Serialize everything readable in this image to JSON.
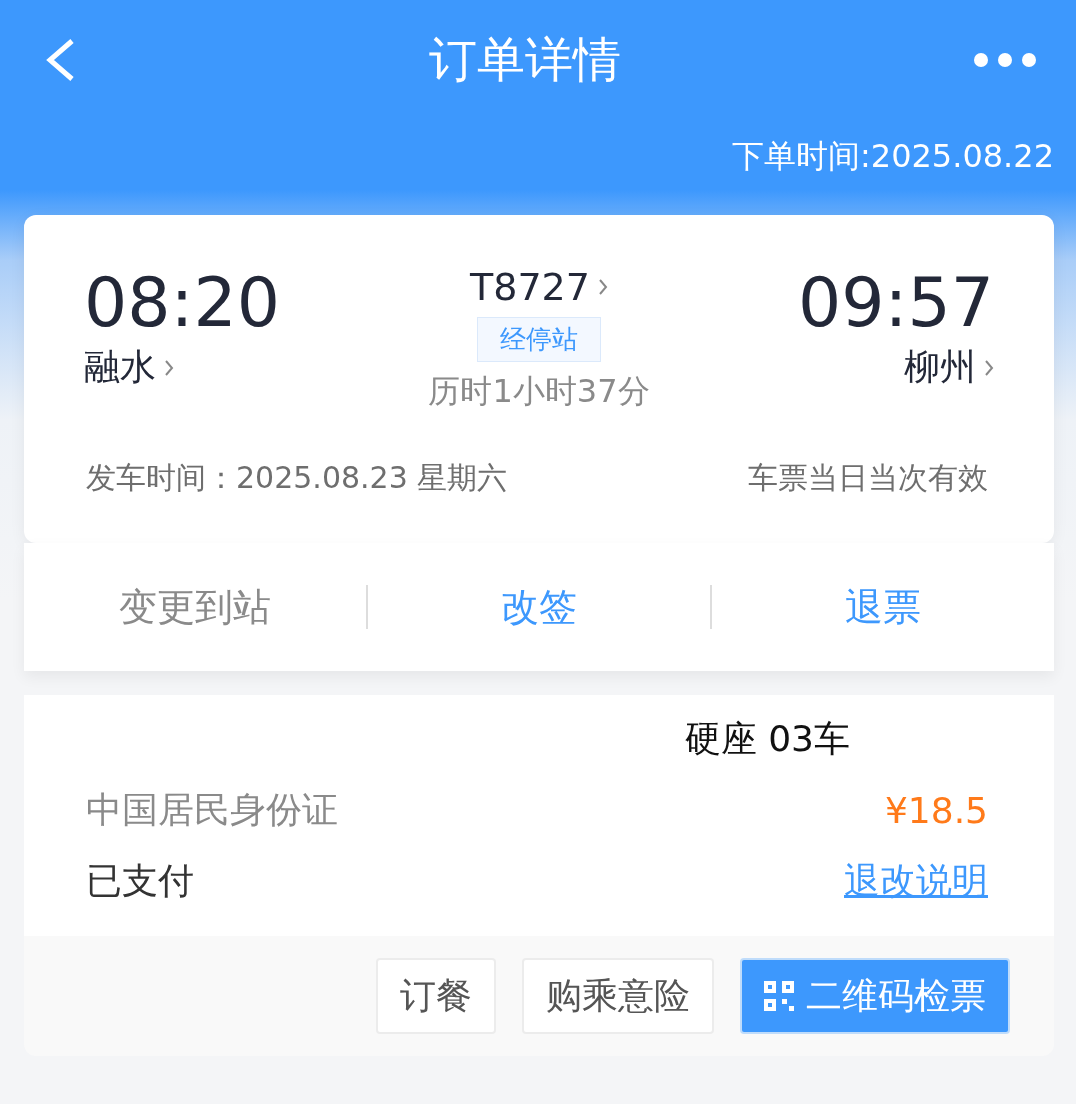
{
  "header": {
    "title": "订单详情",
    "order_time": "下单时间:2025.08.22"
  },
  "trip": {
    "depart_time": "08:20",
    "depart_station": "融水",
    "train_no": "T8727",
    "stops_tag": "经停站",
    "duration": "历时1小时37分",
    "arrive_time": "09:57",
    "arrive_station": "柳州",
    "date": "发车时间：2025.08.23 星期六",
    "validity": "车票当日当次有效"
  },
  "actions": [
    {
      "label": "变更到站",
      "disabled": true
    },
    {
      "label": "改签",
      "disabled": false
    },
    {
      "label": "退票",
      "disabled": false
    }
  ],
  "passenger": {
    "seat": "硬座 03车",
    "id_type": "中国居民身份证",
    "price": "¥18.5",
    "status": "已支付",
    "rules_link": "退改说明"
  },
  "buttons": [
    {
      "label": "订餐",
      "kind": "plain"
    },
    {
      "label": "购乘意险",
      "kind": "plain"
    },
    {
      "label": "二维码检票",
      "kind": "qr"
    }
  ]
}
